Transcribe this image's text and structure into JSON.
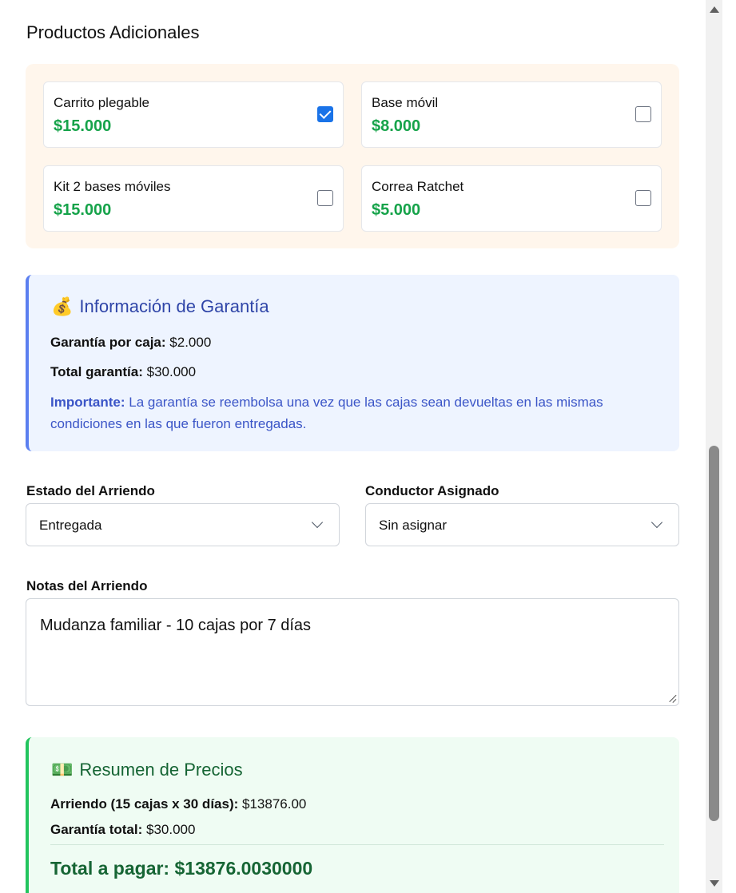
{
  "products_section": {
    "title": "Productos Adicionales",
    "items": [
      {
        "name": "Carrito plegable",
        "price": "$15.000",
        "checked": true
      },
      {
        "name": "Base móvil",
        "price": "$8.000",
        "checked": false
      },
      {
        "name": "Kit 2 bases móviles",
        "price": "$15.000",
        "checked": false
      },
      {
        "name": "Correa Ratchet",
        "price": "$5.000",
        "checked": false
      }
    ]
  },
  "guarantee": {
    "icon": "money-bag-icon",
    "emoji": "💰",
    "title": "Información de Garantía",
    "per_box_label": "Garantía por caja:",
    "per_box_value": "$2.000",
    "total_label": "Total garantía:",
    "total_value": "$30.000",
    "note_label": "Importante:",
    "note_text": "La garantía se reembolsa una vez que las cajas sean devueltas en las mismas condiciones en las que fueron entregadas."
  },
  "form": {
    "status_label": "Estado del Arriendo",
    "status_value": "Entregada",
    "driver_label": "Conductor Asignado",
    "driver_value": "Sin asignar",
    "notes_label": "Notas del Arriendo",
    "notes_value": "Mudanza familiar - 10 cajas por 7 días"
  },
  "summary": {
    "icon": "banknote-icon",
    "emoji": "💵",
    "title": "Resumen de Precios",
    "rental_label": "Arriendo (15 cajas x 30 días):",
    "rental_value": "$13876.00",
    "guarantee_label": "Garantía total:",
    "guarantee_value": "$30.000",
    "total_label": "Total a pagar:",
    "total_value": "$13876.0030000"
  },
  "colors": {
    "price_green": "#16a34a",
    "guarantee_blue": "#2f45a8",
    "summary_green": "#166534",
    "checkbox_blue": "#1a73e8"
  }
}
